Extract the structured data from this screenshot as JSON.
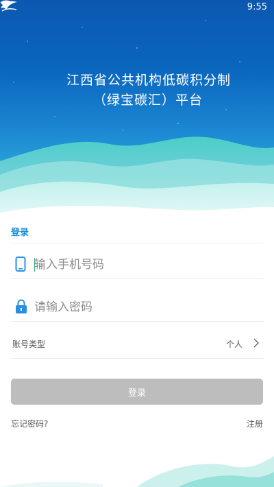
{
  "status_bar": {
    "time": "9:55",
    "icons": [
      "wifi-icon"
    ]
  },
  "header": {
    "title_line1": "江西省公共机构低碳积分制",
    "title_line2": "（绿宝碳汇）平台",
    "logo_icon": "leaf-logo-icon"
  },
  "login": {
    "tab_label": "登录",
    "phone": {
      "placeholder": "输入手机号码",
      "value": "",
      "icon": "phone-icon"
    },
    "password": {
      "placeholder": "请输入密码",
      "value": "",
      "icon": "lock-icon"
    },
    "account_type": {
      "label": "账号类型",
      "value": "个人",
      "icon": "chevron-right-icon"
    },
    "submit_label": "登录",
    "forgot_label": "忘记密码?",
    "register_label": "注册"
  },
  "colors": {
    "accent": "#1a8fd6",
    "button_disabled": "#bdbdbd",
    "header_blue": "#0a66be",
    "wave_teal": "#3cc9c0"
  }
}
